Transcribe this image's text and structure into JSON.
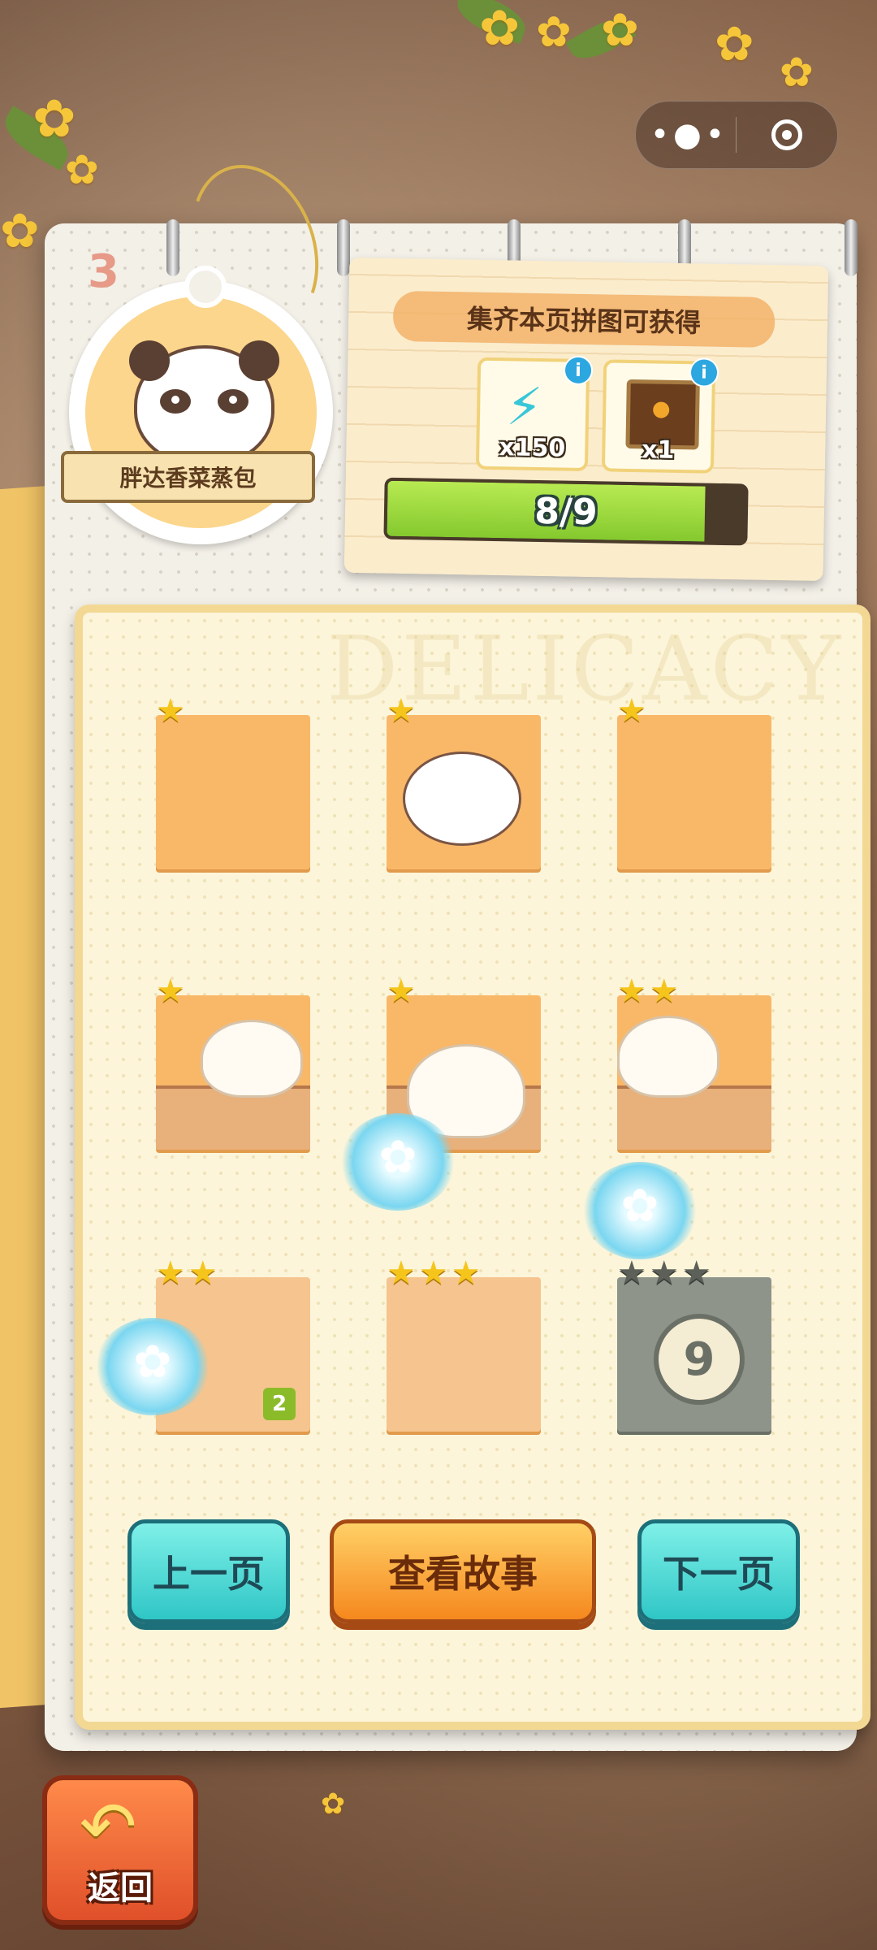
{
  "capsule": {
    "more_icon": "more-dots-icon",
    "target_icon": "target-icon"
  },
  "album": {
    "page_number": "3",
    "watermark": "DELICACY"
  },
  "badge": {
    "title": "胖达香菜蒸包"
  },
  "reward": {
    "title": "集齐本页拼图可获得",
    "items": [
      {
        "icon": "energy-bolt-icon",
        "qty": "x150",
        "info": "i"
      },
      {
        "icon": "treasure-box-icon",
        "qty": "x1",
        "info": "i"
      }
    ],
    "progress_text": "8/9",
    "progress_fraction": 0.8889
  },
  "pieces": [
    {
      "stars": 1,
      "max_stars": 1,
      "locked": false
    },
    {
      "stars": 1,
      "max_stars": 1,
      "locked": false
    },
    {
      "stars": 1,
      "max_stars": 1,
      "locked": false
    },
    {
      "stars": 1,
      "max_stars": 1,
      "locked": false
    },
    {
      "stars": 1,
      "max_stars": 1,
      "locked": false
    },
    {
      "stars": 2,
      "max_stars": 2,
      "locked": false
    },
    {
      "stars": 2,
      "max_stars": 2,
      "locked": false,
      "count": "2"
    },
    {
      "stars": 3,
      "max_stars": 3,
      "locked": false
    },
    {
      "stars": 0,
      "max_stars": 3,
      "locked": true,
      "lock_label": "9"
    }
  ],
  "buttons": {
    "prev": "上一页",
    "story": "查看故事",
    "next": "下一页"
  },
  "back": {
    "label": "返回"
  },
  "colors": {
    "accent_green": "#2fc6c6",
    "accent_orange": "#f5881e",
    "star": "#f5c51c"
  }
}
